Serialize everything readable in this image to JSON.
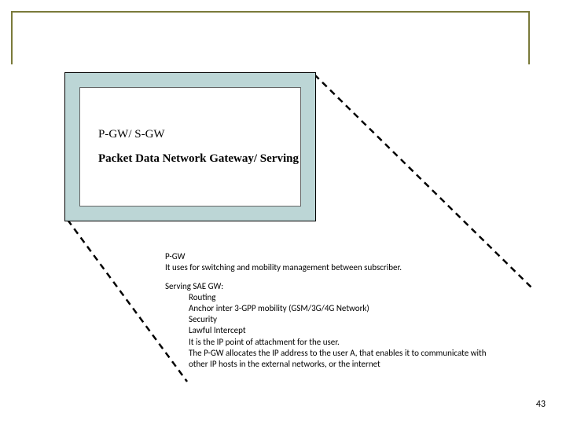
{
  "box": {
    "title": "P-GW/ S-GW",
    "subtitle": "Packet Data Network Gateway/ Serving"
  },
  "description": {
    "pgw_heading": "P-GW",
    "pgw_text": "It uses for switching and mobility management between subscriber.",
    "sae_heading": "Serving SAE GW:",
    "sae_items": [
      "Routing",
      "Anchor inter 3-GPP mobility (GSM/3G/4G Network)",
      "Security",
      "Lawful Intercept",
      "It is the IP point of attachment for the user.",
      "The P-GW allocates the IP address to the user A, that enables it to communicate with other IP hosts in the external networks, or the internet"
    ]
  },
  "page_number": "43"
}
